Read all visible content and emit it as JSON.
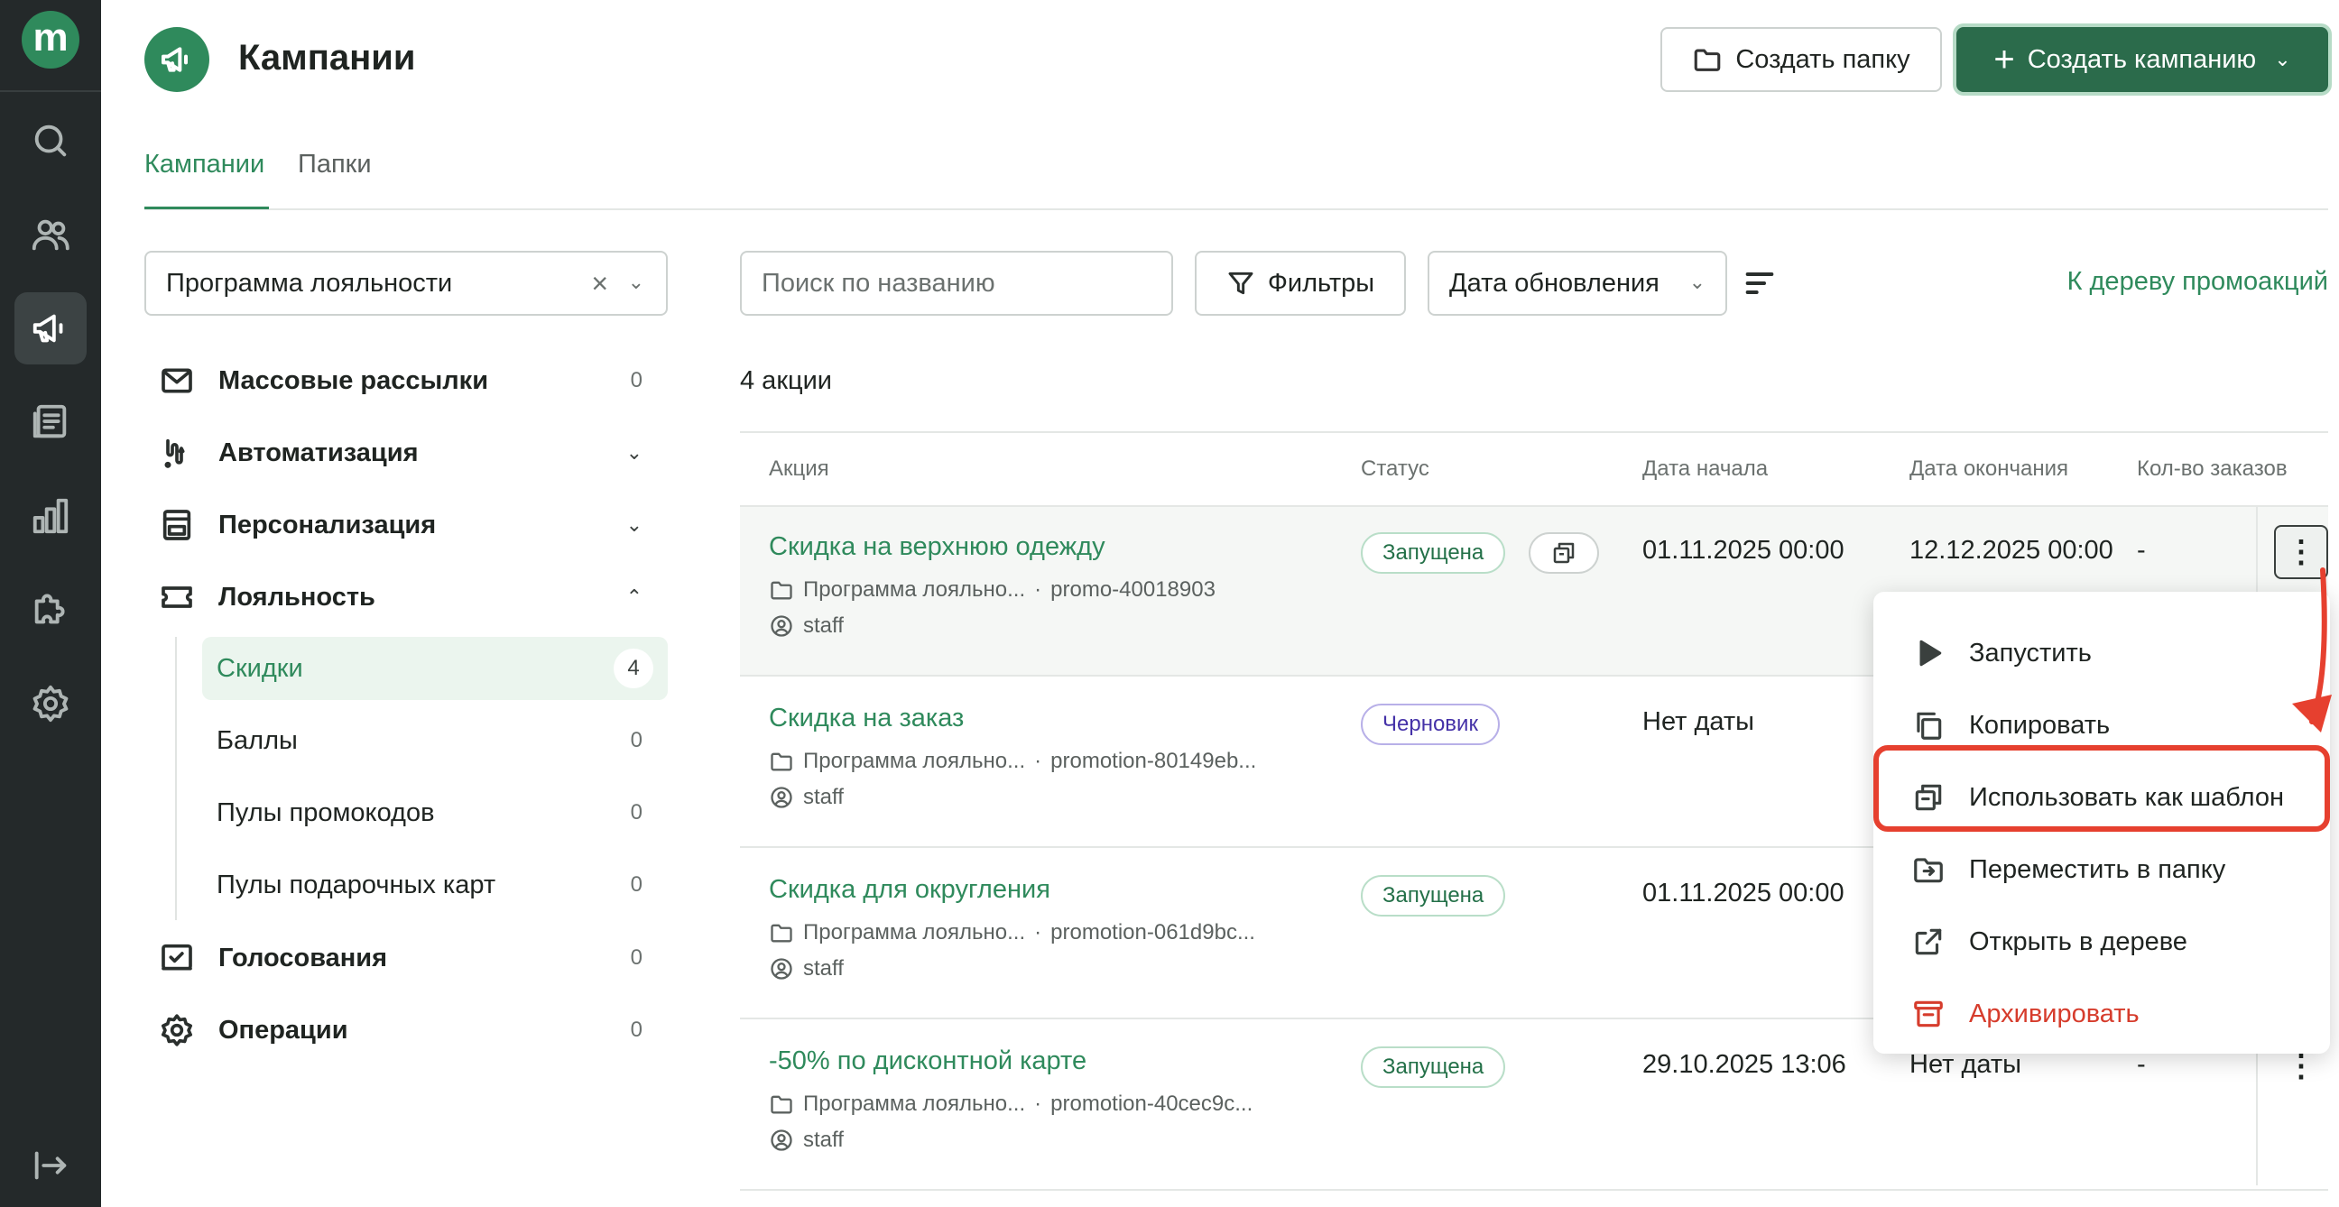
{
  "rail": {
    "logo_letter": "m",
    "items": [
      "search-icon",
      "users-icon",
      "megaphone-icon",
      "news-icon",
      "analytics-icon",
      "puzzle-icon",
      "settings-icon",
      "collapse-icon"
    ]
  },
  "header": {
    "title": "Кампании",
    "create_folder_label": "Создать папку",
    "create_campaign_label": "Создать кампанию"
  },
  "tabs": [
    {
      "label": "Кампании",
      "active": true
    },
    {
      "label": "Папки",
      "active": false
    }
  ],
  "program_select": {
    "value": "Программа лояльности"
  },
  "nav": {
    "mass": {
      "label": "Массовые рассылки",
      "count": "0"
    },
    "automation": {
      "label": "Автоматизация"
    },
    "personal": {
      "label": "Персонализация"
    },
    "loyalty": {
      "label": "Лояльность"
    },
    "loyalty_sub": [
      {
        "label": "Скидки",
        "count": "4",
        "active": true
      },
      {
        "label": "Баллы",
        "count": "0"
      },
      {
        "label": "Пулы промокодов",
        "count": "0"
      },
      {
        "label": "Пулы подарочных карт",
        "count": "0"
      }
    ],
    "votes": {
      "label": "Голосования",
      "count": "0"
    },
    "operations": {
      "label": "Операции",
      "count": "0"
    }
  },
  "toolbar": {
    "search_placeholder": "Поиск по названию",
    "filters_label": "Фильтры",
    "sort_value": "Дата обновления",
    "tree_link": "К дереву промоакций"
  },
  "count_text": "4 акции",
  "table": {
    "headers": {
      "action": "Акция",
      "status": "Статус",
      "start": "Дата начала",
      "end": "Дата окончания",
      "orders": "Кол-во заказов"
    },
    "rows": [
      {
        "name": "Скидка на верхнюю одежду",
        "folder": "Программа лояльно...",
        "code": "promo-40018903",
        "owner": "staff",
        "status": "Запущена",
        "start": "01.11.2025 00:00",
        "end": "12.12.2025 00:00",
        "orders": "-"
      },
      {
        "name": "Скидка на заказ",
        "folder": "Программа лояльно...",
        "code": "promotion-80149eb...",
        "owner": "staff",
        "status": "Черновик",
        "start": "Нет даты",
        "end": "",
        "orders": ""
      },
      {
        "name": "Скидка для округления",
        "folder": "Программа лояльно...",
        "code": "promotion-061d9bc...",
        "owner": "staff",
        "status": "Запущена",
        "start": "01.11.2025 00:00",
        "end": "",
        "orders": ""
      },
      {
        "name": "-50% по дисконтной карте",
        "folder": "Программа лояльно...",
        "code": "promotion-40cec9c...",
        "owner": "staff",
        "status": "Запущена",
        "start": "29.10.2025 13:06",
        "end": "Нет даты",
        "orders": "-"
      }
    ],
    "separator": "·",
    "kebab": "⋮"
  },
  "context_menu": {
    "items": [
      {
        "label": "Запустить",
        "icon": "play-icon"
      },
      {
        "label": "Копировать",
        "icon": "copy-icon"
      },
      {
        "label": "Использовать как шаблон",
        "icon": "template-icon",
        "highlighted": true
      },
      {
        "label": "Переместить в папку",
        "icon": "move-folder-icon"
      },
      {
        "label": "Открыть в дереве",
        "icon": "external-link-icon"
      },
      {
        "label": "Архивировать",
        "icon": "archive-icon",
        "danger": true
      }
    ]
  },
  "colors": {
    "accent": "#2f8a5c",
    "primary_button": "#2b6b4b",
    "rail_bg": "#24292a",
    "highlight": "#e6402f",
    "draft_badge": "#4532a8"
  }
}
